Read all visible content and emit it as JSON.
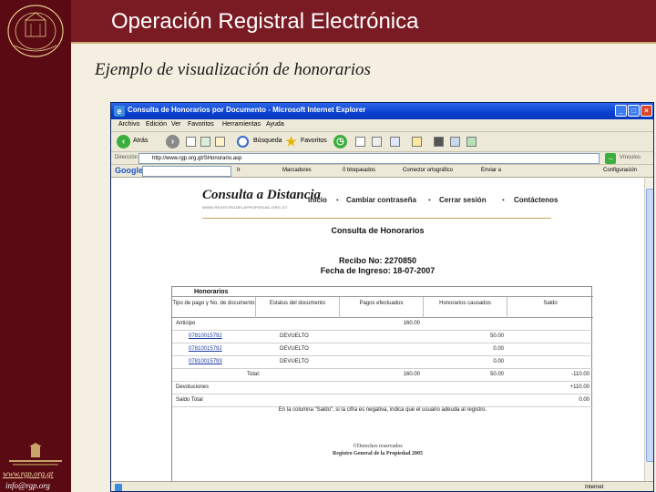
{
  "slide": {
    "title": "Operación Registral Electrónica",
    "subtitle": "Ejemplo de visualización de honorarios",
    "web_url": "www.rgp.org.gt",
    "email": "info@rgp.org",
    "colors": {
      "sidebar": "#5a0a12",
      "title_bar": "#7a1a22",
      "background": "#f4efe0"
    }
  },
  "browser": {
    "window_title": "Consulta de Honorarios por Documento - Microsoft Internet Explorer",
    "window_buttons": [
      "minimize-icon",
      "maximize-icon",
      "close-icon"
    ],
    "menu": [
      "Archivo",
      "Edición",
      "Ver",
      "Favoritos",
      "Herramientas",
      "Ayuda"
    ],
    "toolbar": {
      "back": "Atrás",
      "search": "Búsqueda",
      "favorites": "Favoritos"
    },
    "address_label": "Dirección",
    "address_value": "http://www.rgp.org.gt/SHonorario.asp",
    "links_label": "Vínculos",
    "google": {
      "logo": "Google",
      "items": [
        "Ir",
        "Marcadores",
        "0 bloqueados",
        "Corrector ortográfico",
        "Enviar a",
        "Configuración"
      ]
    },
    "status": "Internet"
  },
  "site": {
    "logo": "Consulta a Distancia",
    "logo_sub": "WWW.REGISTRODELAPROPIEDAD.ORG.GT",
    "nav": [
      "Inicio",
      "Cambiar contraseña",
      "Cerrar sesión",
      "Contáctenos"
    ],
    "heading": "Consulta de Honorarios",
    "receipt_label": "Recibo No:",
    "receipt_no": "2270850",
    "entry_label": "Fecha de Ingreso:",
    "entry_date": "18-07-2007",
    "copyright": "©Derechos reservados",
    "registry": "Registro General de la Propiedad 2005"
  },
  "table": {
    "caption": "Honorarios",
    "headers": [
      "Tipo de pago y No. de documento",
      "Estatus del documento",
      "Pagos efectuados",
      "Honorarios causados",
      "Saldo"
    ],
    "advance": {
      "label": "Anticipo",
      "payment": "160.00"
    },
    "docs": [
      {
        "number": "07810015792",
        "status": "DEVUELTO",
        "fees": "50.00"
      },
      {
        "number": "07810015792",
        "status": "DEVUELTO",
        "fees": "0.00"
      },
      {
        "number": "07810015793",
        "status": "DEVUELTO",
        "fees": "0.00"
      }
    ],
    "total": {
      "label": "Total:",
      "payment": "160.00",
      "fees": "50.00",
      "balance": "-110.00"
    },
    "refunds": {
      "label": "Devoluciones",
      "balance": "+110.00"
    },
    "final": {
      "label": "Saldo Total",
      "balance": "0.00"
    },
    "note": "En la columna \"Saldo\", si la cifra es negativa, indica que el usuario adeuda al registro."
  }
}
